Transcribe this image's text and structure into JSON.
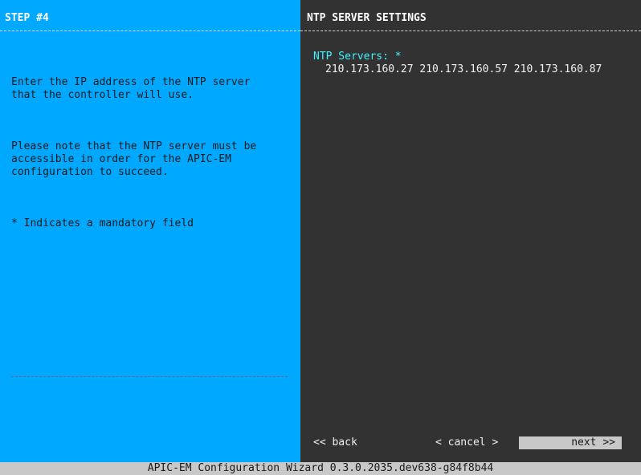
{
  "left_panel": {
    "title": "STEP #4",
    "help": {
      "paragraph1": "Enter the IP address of the NTP server\nthat the controller will use.",
      "paragraph2": "Please note that the NTP server must be\naccessible in order for the APIC-EM\nconfiguration to succeed.",
      "mandatory_note": "* Indicates a mandatory field"
    },
    "colors": {
      "background": "#00a8ff"
    }
  },
  "right_panel": {
    "title": "NTP SERVER SETTINGS",
    "field": {
      "label": "NTP Servers: *",
      "value": "210.173.160.27 210.173.160.57 210.173.160.87"
    },
    "colors": {
      "background": "#323232",
      "label": "#3ff2ff"
    }
  },
  "buttons": {
    "back": "<< back",
    "cancel": "< cancel >",
    "next": "next >>"
  },
  "status_bar": {
    "text": "APIC-EM Configuration Wizard 0.3.0.2035.dev638-g84f8b44"
  }
}
